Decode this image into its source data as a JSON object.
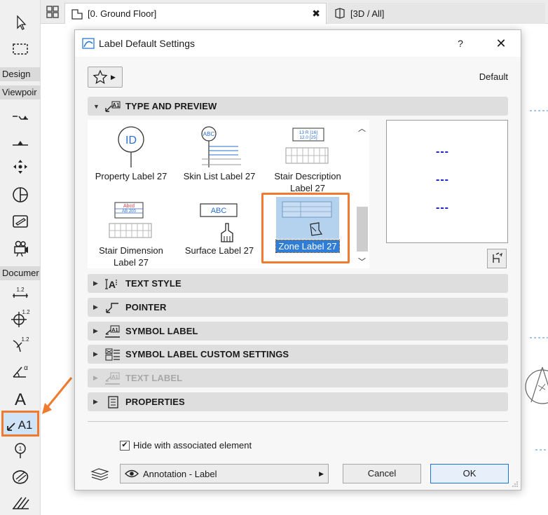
{
  "background": {
    "toolbox": {
      "design_label": "Design",
      "viewpoint_label": "Viewpoir",
      "document_label": "Documer"
    },
    "tabs": [
      {
        "label": "[0. Ground Floor]"
      },
      {
        "label": "[3D / All]"
      }
    ]
  },
  "dialog": {
    "title": "Label Default Settings",
    "help": "?",
    "default_text": "Default",
    "panels": {
      "type_preview": "TYPE AND PREVIEW",
      "text_style": "TEXT STYLE",
      "pointer": "POINTER",
      "symbol_label": "SYMBOL LABEL",
      "symbol_custom": "SYMBOL LABEL CUSTOM SETTINGS",
      "text_label": "TEXT LABEL",
      "properties": "PROPERTIES"
    },
    "types": [
      {
        "label": "Property Label 27",
        "thumb_text": "ID"
      },
      {
        "label": "Skin List Label 27",
        "thumb_text": "ABC"
      },
      {
        "label": "Stair Description Label 27",
        "thumb_text_1": "13 R [16]",
        "thumb_text_2": "12.0 [25]"
      },
      {
        "label": "Stair Dimension Label 27",
        "thumb_text_1": "Abcd",
        "thumb_text_2": "AB 200"
      },
      {
        "label": "Surface Label 27",
        "thumb_text": "ABC"
      },
      {
        "label": "Zone Label 27",
        "selected": true
      }
    ],
    "preview_dashes": [
      "---",
      "---",
      "---"
    ],
    "hide_checkbox": {
      "label": "Hide with associated element",
      "checked": true
    },
    "layer": "Annotation - Label",
    "cancel": "Cancel",
    "ok": "OK"
  },
  "colors": {
    "accent_orange": "#f07a2e",
    "selection_blue": "#2f7dd6",
    "preview_dash": "#1616d0"
  }
}
